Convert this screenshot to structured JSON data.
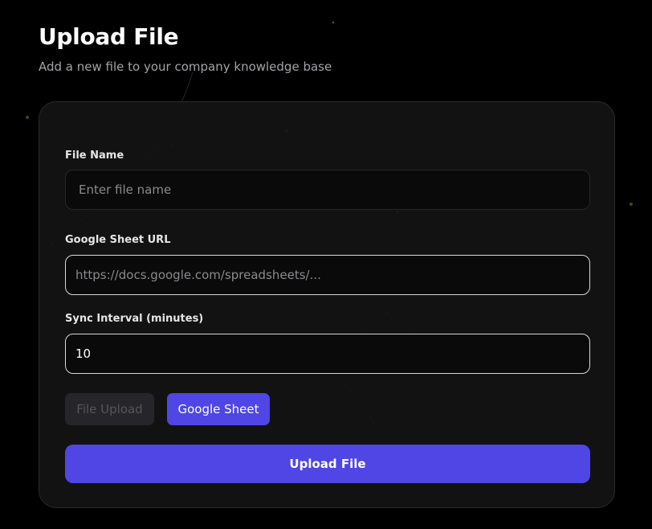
{
  "header": {
    "title": "Upload File",
    "subtitle": "Add a new file to your company knowledge base"
  },
  "form": {
    "file_name": {
      "label": "File Name",
      "placeholder": "Enter file name",
      "value": ""
    },
    "sheet_url": {
      "label": "Google Sheet URL",
      "placeholder": "https://docs.google.com/spreadsheets/...",
      "value": ""
    },
    "sync_interval": {
      "label": "Sync Interval (minutes)",
      "value": "10"
    },
    "source_toggle": {
      "file_upload_label": "File Upload",
      "google_sheet_label": "Google Sheet",
      "selected": "Google Sheet"
    },
    "submit_label": "Upload File"
  },
  "colors": {
    "background": "#000000",
    "card": "#141414",
    "accent": "#4f46e5",
    "disabled": "#26262a",
    "muted_text": "#a3a3a8"
  }
}
